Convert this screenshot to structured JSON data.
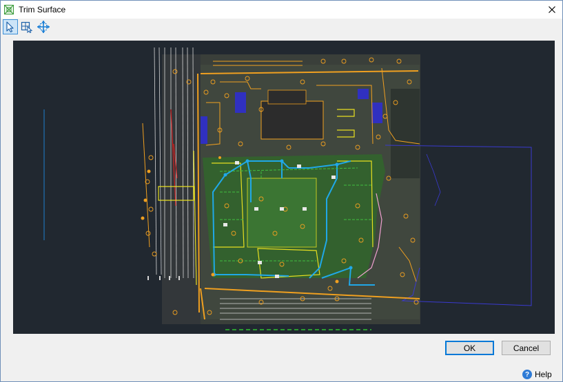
{
  "window": {
    "title": "Trim Surface",
    "icon": "trim-surface-icon",
    "close_icon": "close-icon"
  },
  "toolbar": {
    "tools": [
      {
        "name": "select-tool",
        "icon": "arrow-pointer-icon",
        "active": true
      },
      {
        "name": "boundary-select-tool",
        "icon": "boundary-select-icon",
        "active": false
      },
      {
        "name": "pan-tool",
        "icon": "pan-move-icon",
        "active": false
      }
    ]
  },
  "viewport": {
    "description_icon": "site-plan-drawing",
    "background_color": "#212830"
  },
  "footer": {
    "ok_label": "OK",
    "cancel_label": "Cancel",
    "help_label": "Help",
    "help_icon": "help-icon"
  },
  "colors": {
    "accent": "#0078d7",
    "cad_orange": "#f0a020",
    "cad_yellow": "#e8e020",
    "cad_cyan": "#20a8e8",
    "cad_green": "#30a030",
    "cad_blue": "#3030c0",
    "cad_red": "#d02020"
  }
}
